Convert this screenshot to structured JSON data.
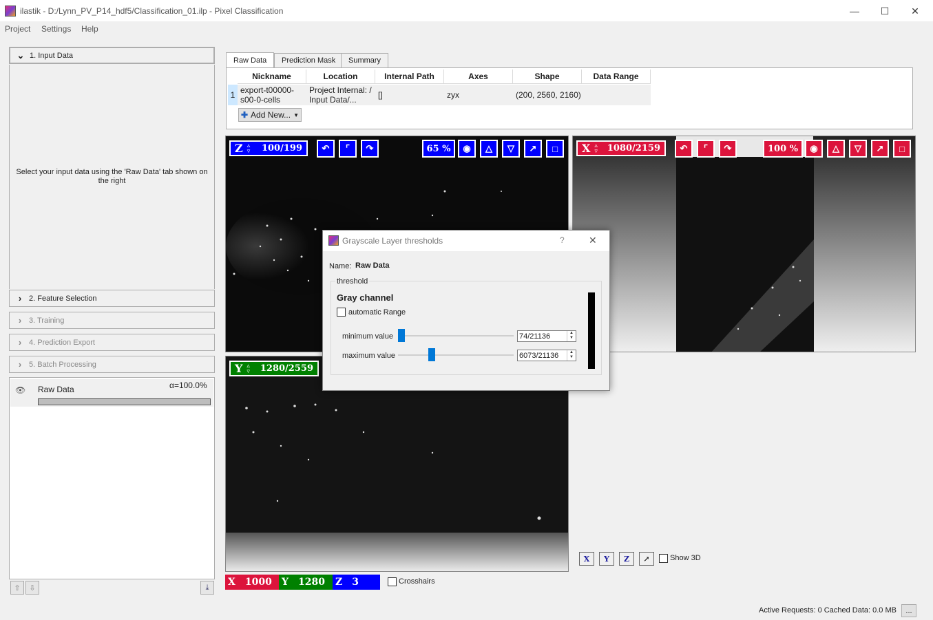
{
  "window": {
    "title": "ilastik - D:/Lynn_PV_P14_hdf5/Classification_01.ilp - Pixel Classification",
    "minimize": "—",
    "maximize": "☐",
    "close": "✕"
  },
  "menu": [
    "Project",
    "Settings",
    "Help"
  ],
  "applets": [
    {
      "label": "1. Input Data",
      "expanded": true
    },
    {
      "label": "2. Feature Selection",
      "expanded": false
    },
    {
      "label": "3. Training",
      "expanded": false
    },
    {
      "label": "4. Prediction Export",
      "expanded": false
    },
    {
      "label": "5. Batch Processing",
      "expanded": false
    }
  ],
  "input_data_hint": "Select your input data using the 'Raw Data' tab shown on the right",
  "layer": {
    "name": "Raw Data",
    "alpha": "α=100.0%"
  },
  "tabs": [
    "Raw Data",
    "Prediction Mask",
    "Summary"
  ],
  "table": {
    "headers": [
      "Nickname",
      "Location",
      "Internal Path",
      "Axes",
      "Shape",
      "Data Range"
    ],
    "rows": [
      {
        "num": "1",
        "nickname": "export-t00000-s00-0-cells",
        "location": "Project Internal: / Input Data/...",
        "internal_path": "[]",
        "axes": "zyx",
        "shape": "(200, 2560, 2160)",
        "data_range": ""
      }
    ],
    "add_new": "Add New..."
  },
  "viewers": {
    "z": {
      "axis": "Z",
      "value": "100/199",
      "zoom": "65 %",
      "color": "#0000ff"
    },
    "x": {
      "axis": "X",
      "value": "1080/2159",
      "zoom": "100 %",
      "color": "#dc143c"
    },
    "y": {
      "axis": "Y",
      "value": "1280/2559",
      "color": "#008000"
    }
  },
  "coords": {
    "x_label": "X",
    "x": "1000",
    "y_label": "Y",
    "y": "1280",
    "z_label": "Z",
    "z": "3"
  },
  "crosshairs_label": "Crosshairs",
  "view_buttons": [
    "X",
    "Y",
    "Z"
  ],
  "show3d_label": "Show 3D",
  "dialog": {
    "title": "Grayscale Layer thresholds",
    "help": "?",
    "close": "✕",
    "name_label": "Name:",
    "name_value": "Raw Data",
    "group_label": "threshold",
    "channel": "Gray channel",
    "auto_range_label": "automatic Range",
    "min_label": "minimum value",
    "min_value": "74/21136",
    "min_fraction": 0.0035,
    "max_label": "maximum value",
    "max_value": "6073/21136",
    "max_fraction": 0.287
  },
  "status": {
    "active_requests": "Active Requests: 0",
    "cached": "Cached Data: 0.0 MB",
    "more": "..."
  }
}
